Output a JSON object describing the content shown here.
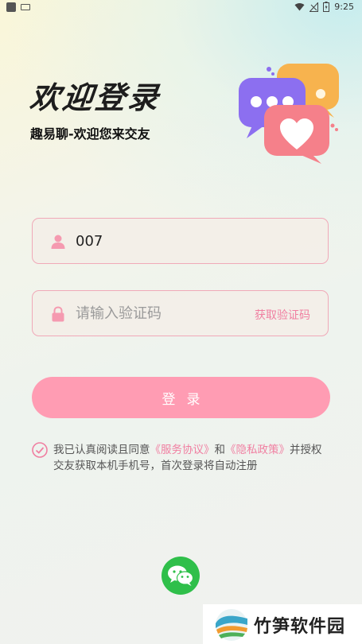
{
  "status_bar": {
    "time": "9:25",
    "icons": [
      "app-icon",
      "keyboard-icon",
      "wifi-icon",
      "signal-icon",
      "battery-icon"
    ]
  },
  "header": {
    "title": "欢迎登录",
    "subtitle": "趣易聊-欢迎您来交友"
  },
  "form": {
    "username": {
      "icon": "user-icon",
      "value": "007"
    },
    "code": {
      "icon": "lock-icon",
      "placeholder": "请输入验证码",
      "get_code_label": "获取验证码"
    },
    "login_label": "登录"
  },
  "agreement": {
    "checked": true,
    "prefix": "我已认真阅读且同意",
    "service_link": "《服务协议》",
    "and": "和",
    "privacy_link": "《隐私政策》",
    "suffix": "并授权交友获取本机手机号，首次登录将自动注册"
  },
  "social_login": {
    "icon": "wechat-icon"
  },
  "watermark": {
    "text": "竹笋软件园"
  },
  "colors": {
    "accent": "#ff9cb3",
    "link": "#f07fa1",
    "field_border": "#f0a9b8",
    "wechat": "#2fbf4a"
  }
}
